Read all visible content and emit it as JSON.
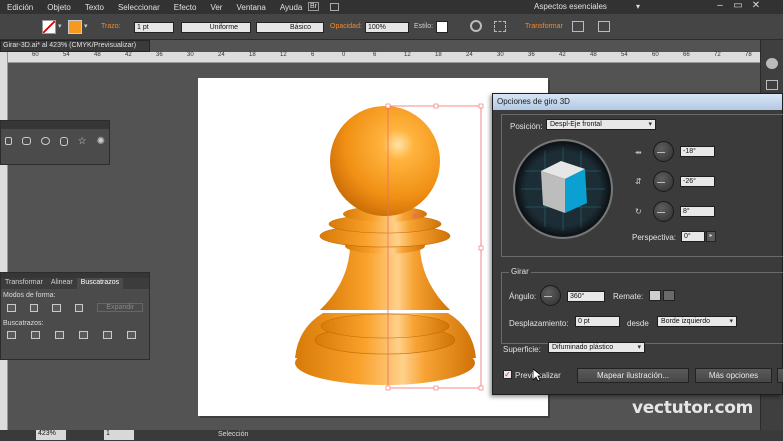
{
  "menu": {
    "items": [
      "Edición",
      "Objeto",
      "Texto",
      "Seleccionar",
      "Efecto",
      "Ver",
      "Ventana",
      "Ayuda"
    ],
    "workspace": "Aspectos esenciales",
    "br_badge": "Br"
  },
  "control_bar": {
    "trazo_label": "Trazo:",
    "stroke_weight": "1 pt",
    "profile": "Uniforme",
    "brush": "Básico",
    "opacity_label": "Opacidad:",
    "opacity_value": "100%",
    "style_label": "Estilo:",
    "transform_link": "Transformar"
  },
  "document": {
    "tab_title": "Girar-3D.ai* al 423% (CMYK/Previsualizar)",
    "ruler_ticks": [
      "60",
      "54",
      "48",
      "42",
      "36",
      "30",
      "24",
      "18",
      "12",
      "6",
      "0",
      "6",
      "12",
      "18",
      "24",
      "30",
      "36",
      "42",
      "48",
      "54",
      "60",
      "66",
      "72",
      "78"
    ]
  },
  "pathfinder_panel": {
    "tabs": [
      "Transformar",
      "Alinear",
      "Buscatrazos"
    ],
    "modes_label": "Modos de forma:",
    "expand_button": "Expandir",
    "pathfinders_label": "Buscatrazos:"
  },
  "dialog": {
    "title": "Opciones de giro 3D",
    "position_label": "Posición:",
    "position_value": "Despl-Eje frontal",
    "x_angle": "-18°",
    "y_angle": "-26°",
    "z_angle": "8°",
    "perspective_label": "Perspectiva:",
    "perspective_value": "0°",
    "revolve_group": "Girar",
    "angle_label": "Ángulo:",
    "angle_value": "360°",
    "cap_label": "Remate:",
    "offset_label": "Desplazamiento:",
    "offset_value": "0 pt",
    "offset_from_label": "desde",
    "offset_from_value": "Borde izquierdo",
    "surface_label": "Superficie:",
    "surface_value": "Difuminado plástico",
    "preview_label": "Previsualizar",
    "preview_checked": true,
    "map_art_button": "Mapear ilustración...",
    "more_options_button": "Más opciones"
  },
  "status_bar": {
    "zoom": "423%",
    "page": "1",
    "selection": "Selección"
  },
  "watermark": "vectutor.com",
  "colors": {
    "pawn_orange": "#f59a1e",
    "cube_blue": "#0aa0d2",
    "accent_orange": "#f08a2a"
  }
}
